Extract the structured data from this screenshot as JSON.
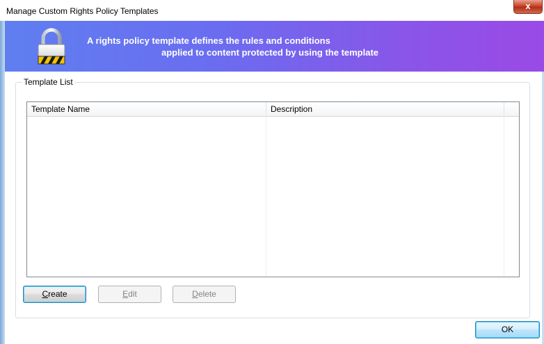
{
  "window": {
    "title": "Manage Custom Rights Policy Templates",
    "close_glyph": "x"
  },
  "banner": {
    "icon": "lock-icon",
    "line1": "A rights policy template defines the rules and conditions",
    "line2": "applied to content protected by using the template",
    "colors": {
      "start": "#5f7ff0",
      "end": "#9a4ae6",
      "text": "#ffffff"
    }
  },
  "template_list": {
    "group_label": "Template List",
    "columns": [
      "Template Name",
      "Description",
      ""
    ],
    "rows": []
  },
  "buttons": {
    "create": {
      "mnemonic": "C",
      "rest": "reate"
    },
    "edit": {
      "mnemonic": "E",
      "rest": "dit"
    },
    "delete": {
      "mnemonic": "D",
      "rest": "elete"
    },
    "ok": "OK"
  }
}
